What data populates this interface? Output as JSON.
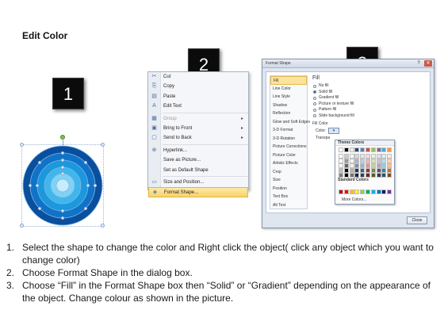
{
  "title": "Edit Color",
  "steps": [
    "1",
    "2",
    "3"
  ],
  "context_menu": {
    "items": [
      {
        "label": "Cut",
        "icon": "scissors-icon",
        "glyph": "✂",
        "disabled": false,
        "submenu": false
      },
      {
        "label": "Copy",
        "icon": "copy-icon",
        "glyph": "⎘",
        "disabled": false,
        "submenu": false
      },
      {
        "label": "Paste",
        "icon": "paste-icon",
        "glyph": "▤",
        "disabled": false,
        "submenu": false
      },
      {
        "label": "Edit Text",
        "icon": "edit-text-icon",
        "glyph": "A",
        "disabled": false,
        "submenu": false
      },
      {
        "label": "Group",
        "icon": "group-icon",
        "glyph": "▦",
        "disabled": true,
        "submenu": true
      },
      {
        "label": "Bring to Front",
        "icon": "bring-front-icon",
        "glyph": "▣",
        "disabled": false,
        "submenu": true
      },
      {
        "label": "Send to Back",
        "icon": "send-back-icon",
        "glyph": "▢",
        "disabled": false,
        "submenu": true
      },
      {
        "label": "Hyperlink...",
        "icon": "hyperlink-icon",
        "glyph": "⊕",
        "disabled": false,
        "submenu": false
      },
      {
        "label": "Save as Picture...",
        "icon": "",
        "glyph": "",
        "disabled": false,
        "submenu": false
      },
      {
        "label": "Set as Default Shape",
        "icon": "",
        "glyph": "",
        "disabled": false,
        "submenu": false
      },
      {
        "label": "Size and Position...",
        "icon": "size-position-icon",
        "glyph": "▭",
        "disabled": false,
        "submenu": false
      },
      {
        "label": "Format Shape...",
        "icon": "format-shape-icon",
        "glyph": "◈",
        "disabled": false,
        "submenu": false
      }
    ]
  },
  "dialog": {
    "title": "Format Shape",
    "help": "?",
    "close": "✕",
    "categories": [
      "Fill",
      "Line Color",
      "Line Style",
      "Shadow",
      "Reflection",
      "Glow and Soft Edges",
      "3-D Format",
      "3-D Rotation",
      "Picture Corrections",
      "Picture Color",
      "Artistic Effects",
      "Crop",
      "Size",
      "Position",
      "Text Box",
      "Alt Text"
    ],
    "active_category": "Fill",
    "pane_heading": "Fill",
    "fill_options": [
      {
        "label": "No fill",
        "selected": false
      },
      {
        "label": "Solid fill",
        "selected": true
      },
      {
        "label": "Gradient fill",
        "selected": false
      },
      {
        "label": "Picture or texture fill",
        "selected": false
      },
      {
        "label": "Pattern fill",
        "selected": false
      },
      {
        "label": "Slide background fill",
        "selected": false
      }
    ],
    "fill_color_label": "Fill Color",
    "color_label": "Color:",
    "transparency_label": "Transpa",
    "close_button": "Close"
  },
  "palette": {
    "theme_title": "Theme Colors",
    "standard_title": "Standard Colors",
    "more_colors": "More Colors...",
    "theme_top": [
      "#ffffff",
      "#000000",
      "#eeece1",
      "#1f497d",
      "#4f81bd",
      "#c0504d",
      "#9bbb59",
      "#8064a2",
      "#4bacc6",
      "#f79646"
    ],
    "standard": [
      "#c00000",
      "#ff0000",
      "#ffc000",
      "#ffff00",
      "#92d050",
      "#00b050",
      "#00b0f0",
      "#0070c0",
      "#002060",
      "#7030a0"
    ]
  },
  "instructions": [
    {
      "num": "1.",
      "text": "Select the shape to change the color and Right click the object( click any object which you want to change color)"
    },
    {
      "num": "2.",
      "text": "Choose Format Shape in the dialog box."
    },
    {
      "num": "3.",
      "text": "Choose “Fill” in the Format Shape box then “Solid” or “Gradient” depending on the appearance of the object. Change colour as shown in the picture."
    }
  ],
  "colors": {
    "circle_rings": [
      "#0a4f9e",
      "#1173c7",
      "#1c98dd",
      "#40b6ea",
      "#80d2f4",
      "#c4ecfb"
    ],
    "menu_highlight": "#f8d36a",
    "badge_bg": "#0b0b0b"
  }
}
